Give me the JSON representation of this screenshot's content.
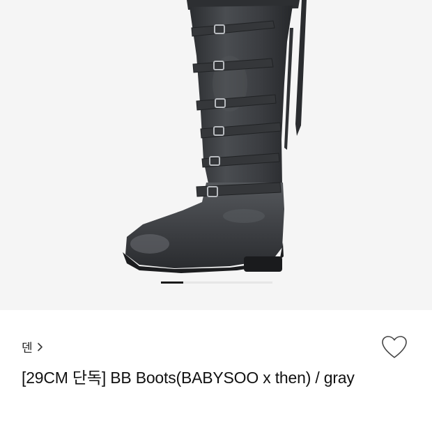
{
  "product": {
    "brand": "덴",
    "title": "[29CM 단독] BB Boots(BABYSOO x then) / gray"
  },
  "gallery": {
    "image_description": "black distressed knee-high buckle boot",
    "page_count": 5,
    "current_page": 1
  },
  "icons": {
    "brand_chevron": "chevron-right-icon",
    "wishlist": "heart-outline-icon"
  },
  "colors": {
    "gallery_bg": "#f5f5f5",
    "boot": "#3a3c3f",
    "text": "#111111"
  }
}
